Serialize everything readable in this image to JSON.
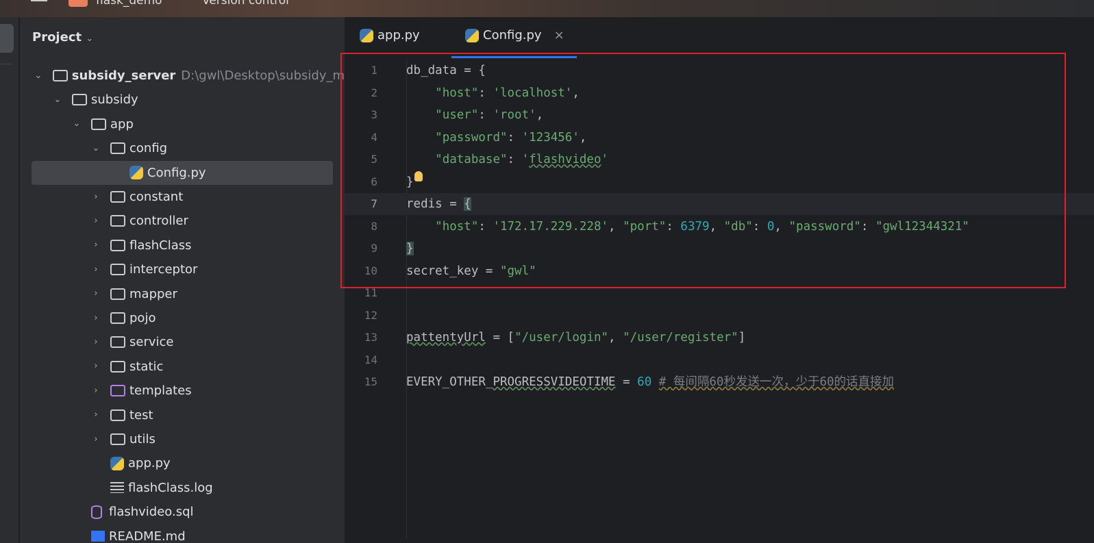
{
  "titlebar": {
    "project": "flask_demo",
    "vcs": "Version control"
  },
  "project_panel": {
    "title": "Project",
    "tree": [
      {
        "label": "subsidy_server",
        "path": "D:\\gwl\\Desktop\\subsidy_m",
        "kind": "folder",
        "depth": 0,
        "expanded": true,
        "bold": true
      },
      {
        "label": "subsidy",
        "kind": "folder",
        "depth": 1,
        "expanded": true
      },
      {
        "label": "app",
        "kind": "folder",
        "depth": 2,
        "expanded": true
      },
      {
        "label": "config",
        "kind": "folder",
        "depth": 3,
        "expanded": true
      },
      {
        "label": "Config.py",
        "kind": "python",
        "depth": 4,
        "selected": true
      },
      {
        "label": "constant",
        "kind": "folder",
        "depth": 3
      },
      {
        "label": "controller",
        "kind": "folder",
        "depth": 3
      },
      {
        "label": "flashClass",
        "kind": "folder",
        "depth": 3
      },
      {
        "label": "interceptor",
        "kind": "folder",
        "depth": 3
      },
      {
        "label": "mapper",
        "kind": "folder",
        "depth": 3
      },
      {
        "label": "pojo",
        "kind": "folder",
        "depth": 3
      },
      {
        "label": "service",
        "kind": "folder",
        "depth": 3
      },
      {
        "label": "static",
        "kind": "folder",
        "depth": 3
      },
      {
        "label": "templates",
        "kind": "folder-purple",
        "depth": 3
      },
      {
        "label": "test",
        "kind": "folder",
        "depth": 3
      },
      {
        "label": "utils",
        "kind": "folder",
        "depth": 3
      },
      {
        "label": "app.py",
        "kind": "python",
        "depth": 3,
        "leaf": true
      },
      {
        "label": "flashClass.log",
        "kind": "log",
        "depth": 3,
        "leaf": true
      },
      {
        "label": "flashvideo.sql",
        "kind": "db",
        "depth": 2,
        "leaf": true
      },
      {
        "label": "README.md",
        "kind": "md",
        "depth": 2,
        "leaf": true
      }
    ]
  },
  "tabs": [
    {
      "label": "app.py",
      "active": false
    },
    {
      "label": "Config.py",
      "active": true,
      "close": "×"
    }
  ],
  "editor": {
    "current_line": 7,
    "lines": [
      [
        [
          "db_data = {",
          ""
        ]
      ],
      [
        [
          "    ",
          ""
        ],
        [
          "\"host\"",
          "t-str"
        ],
        [
          ": ",
          ""
        ],
        [
          "'localhost'",
          "t-str"
        ],
        [
          ",",
          ""
        ]
      ],
      [
        [
          "    ",
          ""
        ],
        [
          "\"user\"",
          "t-str"
        ],
        [
          ": ",
          ""
        ],
        [
          "'root'",
          "t-str"
        ],
        [
          ",",
          ""
        ]
      ],
      [
        [
          "    ",
          ""
        ],
        [
          "\"password\"",
          "t-str"
        ],
        [
          ": ",
          ""
        ],
        [
          "'123456'",
          "t-str"
        ],
        [
          ",",
          ""
        ]
      ],
      [
        [
          "    ",
          ""
        ],
        [
          "\"database\"",
          "t-str"
        ],
        [
          ": ",
          ""
        ],
        [
          "'",
          "t-str"
        ],
        [
          "flashvideo",
          "t-str t-wavy"
        ],
        [
          "'",
          "t-str"
        ]
      ],
      [
        [
          "}",
          ""
        ]
      ],
      [
        [
          "redis = ",
          ""
        ],
        [
          "{",
          "t-brace"
        ]
      ],
      [
        [
          "    ",
          ""
        ],
        [
          "\"host\"",
          "t-str"
        ],
        [
          ": ",
          ""
        ],
        [
          "'172.17.229.228'",
          "t-str"
        ],
        [
          ", ",
          ""
        ],
        [
          "\"port\"",
          "t-str"
        ],
        [
          ": ",
          ""
        ],
        [
          "6379",
          "t-num"
        ],
        [
          ", ",
          ""
        ],
        [
          "\"db\"",
          "t-str"
        ],
        [
          ": ",
          ""
        ],
        [
          "0",
          "t-num"
        ],
        [
          ", ",
          ""
        ],
        [
          "\"password\"",
          "t-str"
        ],
        [
          ": ",
          ""
        ],
        [
          "\"gwl12344321\"",
          "t-str"
        ]
      ],
      [
        [
          "}",
          "t-brace"
        ]
      ],
      [
        [
          "secret_key = ",
          ""
        ],
        [
          "\"gwl\"",
          "t-str"
        ]
      ],
      [],
      [],
      [
        [
          "pattentyUrl",
          "t-wavy"
        ],
        [
          " = [",
          ""
        ],
        [
          "\"/user/login\"",
          "t-str"
        ],
        [
          ", ",
          ""
        ],
        [
          "\"/user/register\"",
          "t-str"
        ],
        [
          "]",
          ""
        ]
      ],
      [],
      [
        [
          "EVERY_OTHER_",
          ""
        ],
        [
          "PROGRESSVIDEOTIME",
          "t-wavy"
        ],
        [
          " = ",
          ""
        ],
        [
          "60",
          "t-num"
        ],
        [
          " ",
          ""
        ],
        [
          "# 每间隔60秒发送一次，少于60的话直接加",
          "t-cmt t-wavyc"
        ]
      ]
    ]
  }
}
